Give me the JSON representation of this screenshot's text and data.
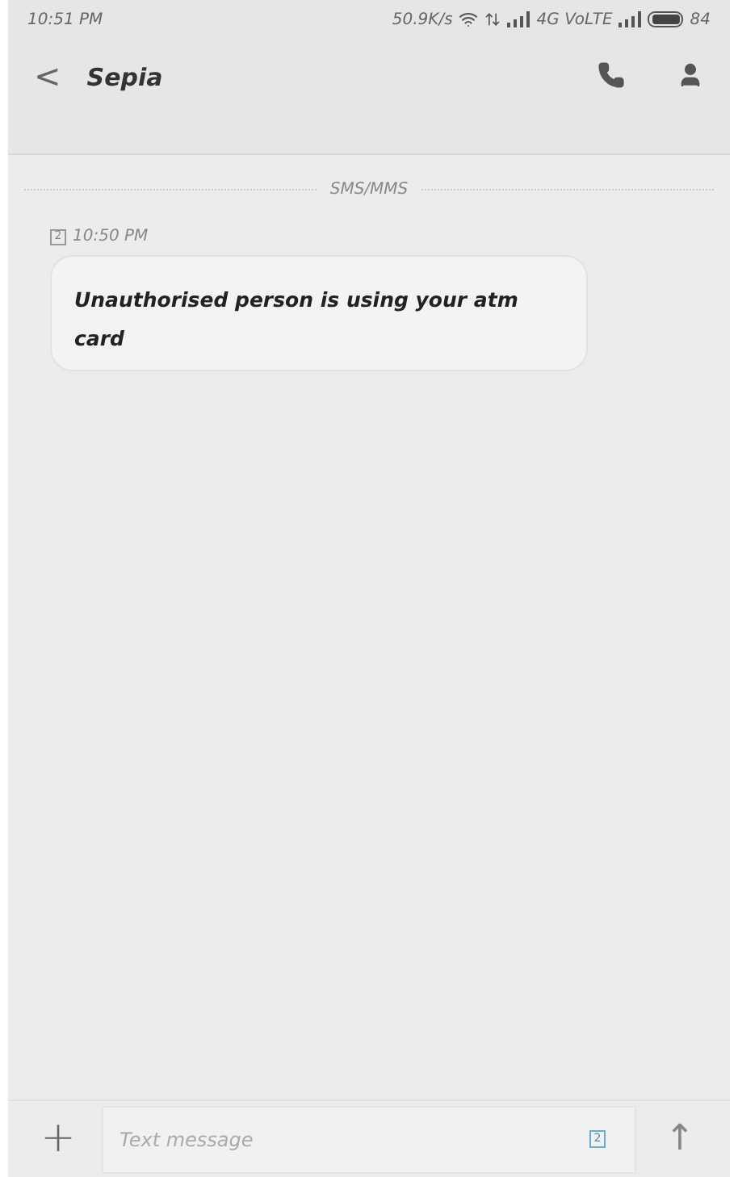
{
  "status_bar": {
    "time": "10:51 PM",
    "speed": "50.9K/s",
    "network": "4G VoLTE",
    "battery": "84"
  },
  "header": {
    "back": "<",
    "title": "Sepia"
  },
  "conversation": {
    "channel": "SMS/MMS",
    "messages": [
      {
        "sim": "2",
        "time": "10:50 PM",
        "text": "Unauthorised person is using your atm card"
      }
    ]
  },
  "composer": {
    "plus": "+",
    "placeholder": "Text message",
    "sim": "2",
    "send": "↑"
  }
}
